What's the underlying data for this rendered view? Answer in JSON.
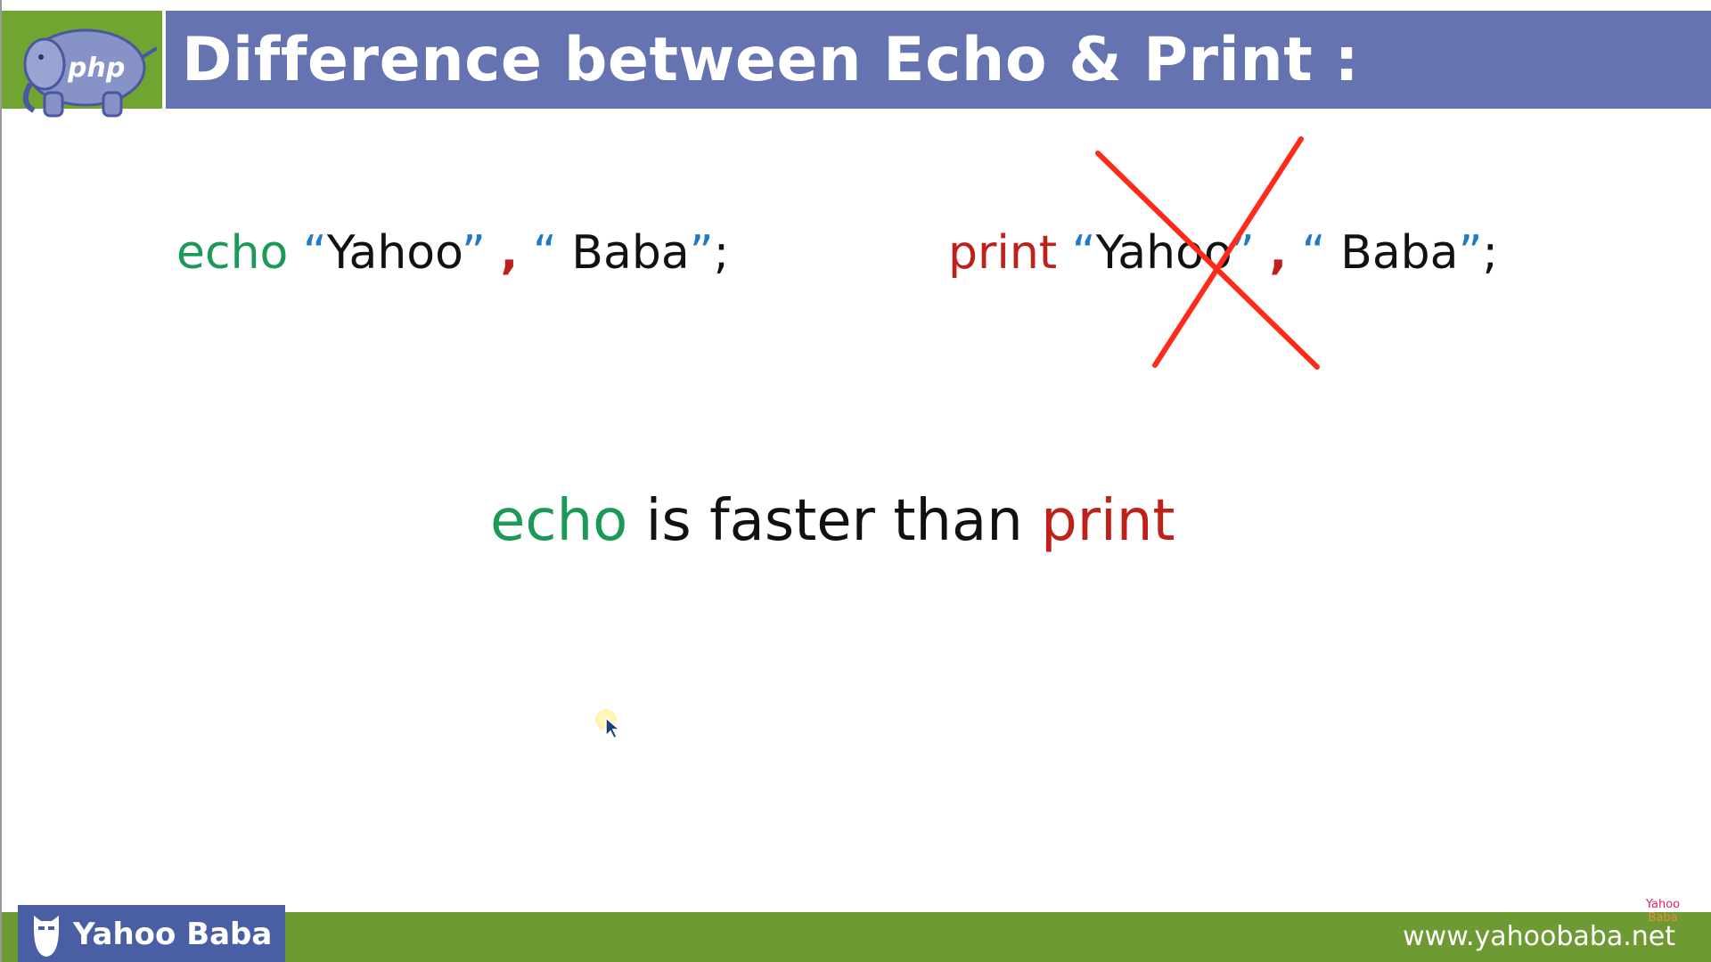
{
  "header": {
    "title": "Difference between Echo & Print :",
    "logo_text": "php",
    "logo_icon": "php-elephant-icon"
  },
  "colors": {
    "header_bar": "#6574b0",
    "logo_bg": "#71a532",
    "footer_bar": "#6e9a33",
    "brand_box": "#4a5fa3",
    "echo_keyword": "#1a9a56",
    "print_keyword": "#c0201a",
    "quote_marks": "#1f78c8",
    "cross_mark": "#ff2a1a"
  },
  "echo_example": {
    "keyword": "echo",
    "open_quote_1": "“",
    "text_1": "Yahoo",
    "close_quote_1": "”",
    "comma": ",",
    "open_quote_2": "“",
    "text_2": " Baba",
    "close_quote_2": "”",
    "terminator": ";"
  },
  "print_example": {
    "keyword": "print",
    "open_quote_1": "“",
    "text_1": "Yahoo",
    "close_quote_1": "”",
    "comma": ",",
    "open_quote_2": "“",
    "text_2": " Baba",
    "close_quote_2": "”",
    "terminator": ";",
    "status_icon": "cross-icon"
  },
  "statement": {
    "subject": "echo",
    "middle": " is faster than ",
    "object": "print"
  },
  "footer": {
    "brand_name": "Yahoo Baba",
    "brand_icon": "bearded-face-icon",
    "website": "www.yahoobaba.net",
    "watermark_top": "Yahoo",
    "watermark_bottom": "Baba"
  },
  "cursor_icon": "mouse-pointer-icon"
}
